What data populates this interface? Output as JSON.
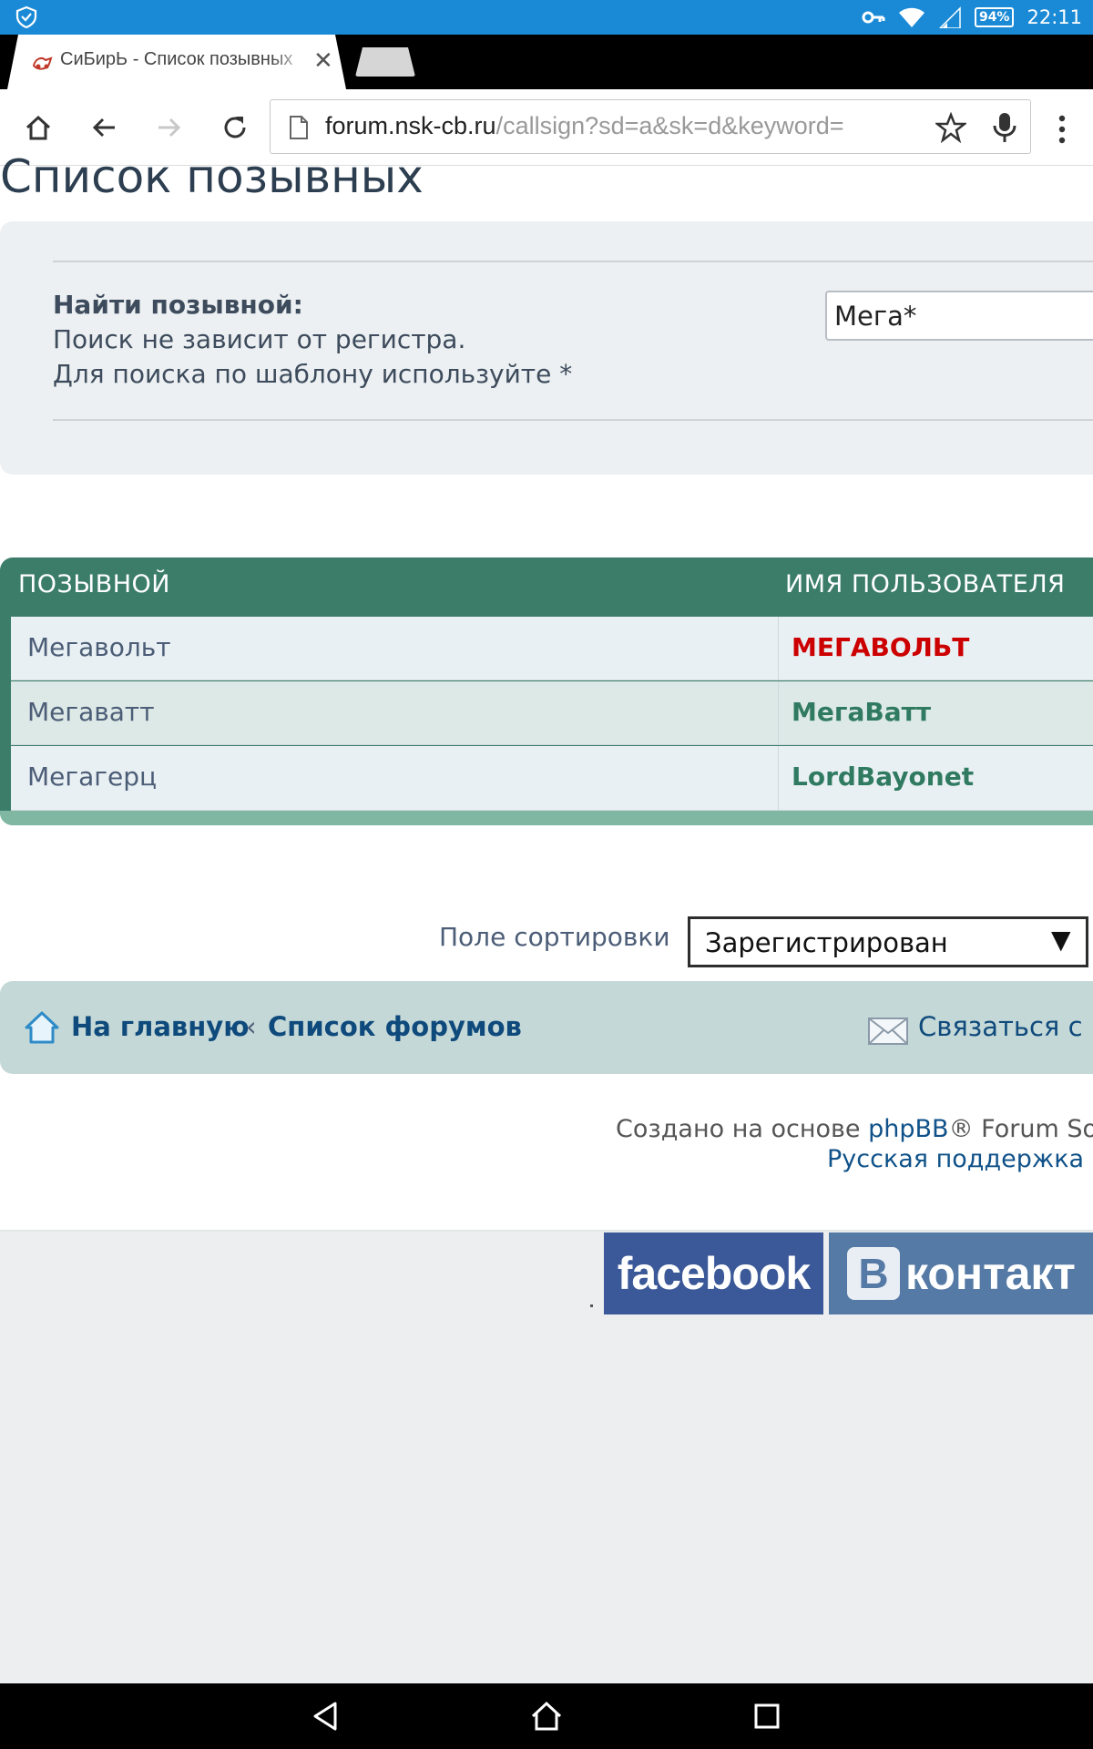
{
  "status_bar": {
    "time": "22:11",
    "battery": "94%",
    "icons": [
      "shield-icon",
      "key-icon",
      "wifi-icon",
      "signal-icon",
      "battery-icon"
    ]
  },
  "browser": {
    "tab_title": "СиБирЬ - Список позывных",
    "url_host": "forum.nsk-cb.ru",
    "url_path": "/callsign?sd=a&sk=d&keyword="
  },
  "page": {
    "title": "Список позывных",
    "search": {
      "label": "Найти позывной:",
      "help_line1": "Поиск не зависит от регистра.",
      "help_line2": "Для поиска по шаблону используйте *",
      "input_value": "Мега*"
    },
    "table": {
      "columns": [
        "ПОЗЫВНОЙ",
        "ИМЯ ПОЛЬЗОВАТЕЛЯ"
      ],
      "rows": [
        {
          "callsign": "Мегавольт",
          "username": "МЕГАВОЛЬТ",
          "username_color": "#cc0000"
        },
        {
          "callsign": "Мегаватт",
          "username": "МегаВатт",
          "username_color": "#2f7a60"
        },
        {
          "callsign": "Мегагерц",
          "username": "LordBayonet",
          "username_color": "#2f7a60"
        }
      ]
    },
    "sort": {
      "label": "Поле сортировки",
      "selected": "Зарегистрирован"
    },
    "nav": {
      "home": "На главную",
      "separator": "‹",
      "forums": "Список форумов",
      "contact": "Связаться с"
    },
    "credits": {
      "line1_prefix": "Создано на основе ",
      "line1_link": "phpBB",
      "line1_suffix": "® Forum Sof",
      "line2": "Русская поддержка р"
    },
    "social": {
      "facebook": "facebook",
      "vk_letter": "В",
      "vk_text": "контакт"
    }
  },
  "colors": {
    "status_bar": "#1b8ad6",
    "table_header": "#3c7d6a",
    "link": "#0f4a7c"
  }
}
